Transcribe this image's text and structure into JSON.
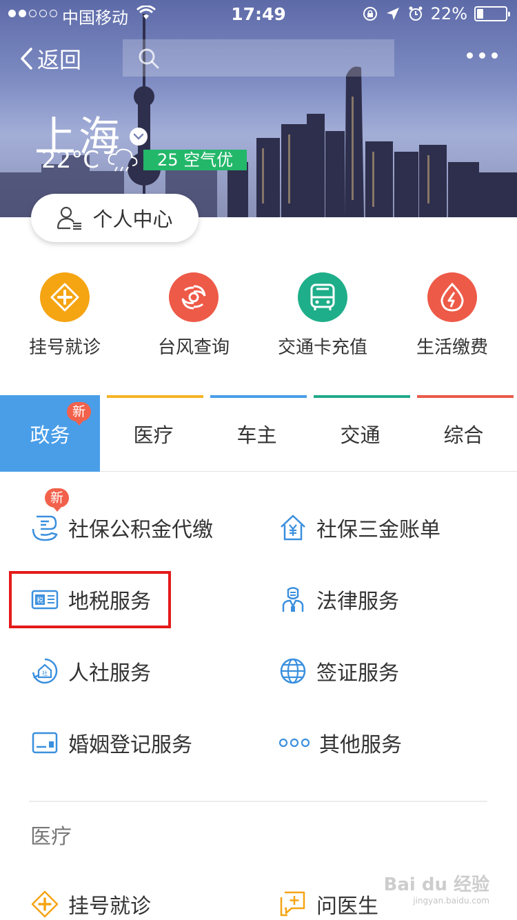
{
  "status_bar": {
    "carrier": "中国移动",
    "time": "17:49",
    "battery_text": "22%",
    "battery_level": 0.22,
    "signal_bars_filled": 2,
    "signal_bars_total": 5
  },
  "nav": {
    "back_label": "返回",
    "search_placeholder": ""
  },
  "weather": {
    "city": "上海",
    "temperature": "22°C",
    "aqi_label": "25 空气优"
  },
  "profile_button": "个人中心",
  "quick_links": [
    {
      "label": "挂号就诊",
      "icon": "medical-plus-icon",
      "color": "#f5a412"
    },
    {
      "label": "台风查询",
      "icon": "typhoon-icon",
      "color": "#ee5a48"
    },
    {
      "label": "交通卡充值",
      "icon": "bus-icon",
      "color": "#1fae8a"
    },
    {
      "label": "生活缴费",
      "icon": "lightning-drop-icon",
      "color": "#ee5a48"
    }
  ],
  "tabs": [
    {
      "label": "政务",
      "active": true,
      "badge": "新",
      "accent": "#4a9ee8"
    },
    {
      "label": "医疗",
      "active": false,
      "accent": "#f5b323"
    },
    {
      "label": "车主",
      "active": false,
      "accent": "#4a9ee8"
    },
    {
      "label": "交通",
      "active": false,
      "accent": "#22a98a"
    },
    {
      "label": "综合",
      "active": false,
      "accent": "#ea5a4a"
    }
  ],
  "services": [
    {
      "label": "社保公积金代缴",
      "icon": "hand-coin-icon",
      "badge": "新"
    },
    {
      "label": "社保三金账单",
      "icon": "house-yen-icon"
    },
    {
      "label": "地税服务",
      "icon": "tax-card-icon",
      "highlighted": true
    },
    {
      "label": "法律服务",
      "icon": "lawyer-icon"
    },
    {
      "label": "人社服务",
      "icon": "community-icon"
    },
    {
      "label": "签证服务",
      "icon": "globe-icon"
    },
    {
      "label": "婚姻登记服务",
      "icon": "certificate-icon"
    },
    {
      "label": "其他服务",
      "icon": "more-dots-icon"
    }
  ],
  "medical_section": {
    "title": "医疗",
    "items": [
      {
        "label": "挂号就诊",
        "icon": "medical-plus-icon"
      },
      {
        "label": "问医生",
        "icon": "chat-plus-icon"
      }
    ]
  },
  "watermark": {
    "main": "Bai du 经验",
    "sub": "jingyan.baidu.com"
  },
  "colors": {
    "primary_blue": "#4a9ee8",
    "aqi_green": "#23b76a",
    "badge_red": "#f2614b",
    "highlight_red": "#e41a1a",
    "icon_blue": "#3a8fde",
    "icon_orange": "#f5a412"
  }
}
